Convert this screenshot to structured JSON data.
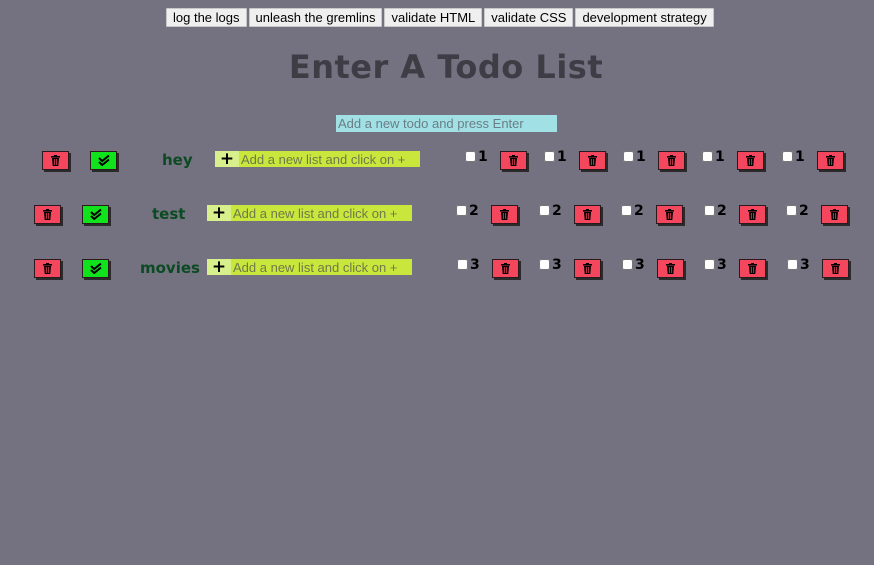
{
  "toolbar": {
    "buttons": [
      "log the logs",
      "unleash the gremlins",
      "validate HTML",
      "validate CSS",
      "development strategy"
    ]
  },
  "title": "Enter A Todo List",
  "new_todo": {
    "placeholder": "Add a new todo and press Enter",
    "value": ""
  },
  "icons": {
    "delete": "trash-icon",
    "complete": "double-check-icon",
    "add": "plus-icon"
  },
  "colors": {
    "background": "#747280",
    "delete_button": "#f4475e",
    "complete_button": "#10e21c",
    "list_input": "#c9e63d",
    "new_todo_input": "#a1e0e5",
    "todo_name": "#0b4a22"
  },
  "todos": [
    {
      "name": "hey",
      "add_list_placeholder": "Add a new list and click on +",
      "add_label": "+",
      "items": [
        {
          "label": "1",
          "checked": false
        },
        {
          "label": "1",
          "checked": false
        },
        {
          "label": "1",
          "checked": false
        },
        {
          "label": "1",
          "checked": false
        },
        {
          "label": "1",
          "checked": false
        }
      ]
    },
    {
      "name": "test",
      "add_list_placeholder": "Add a new list and click on +",
      "add_label": "+",
      "items": [
        {
          "label": "2",
          "checked": false
        },
        {
          "label": "2",
          "checked": false
        },
        {
          "label": "2",
          "checked": false
        },
        {
          "label": "2",
          "checked": false
        },
        {
          "label": "2",
          "checked": false
        }
      ]
    },
    {
      "name": "movies",
      "add_list_placeholder": "Add a new list and click on +",
      "add_label": "+",
      "items": [
        {
          "label": "3",
          "checked": false
        },
        {
          "label": "3",
          "checked": false
        },
        {
          "label": "3",
          "checked": false
        },
        {
          "label": "3",
          "checked": false
        },
        {
          "label": "3",
          "checked": false
        }
      ]
    }
  ]
}
